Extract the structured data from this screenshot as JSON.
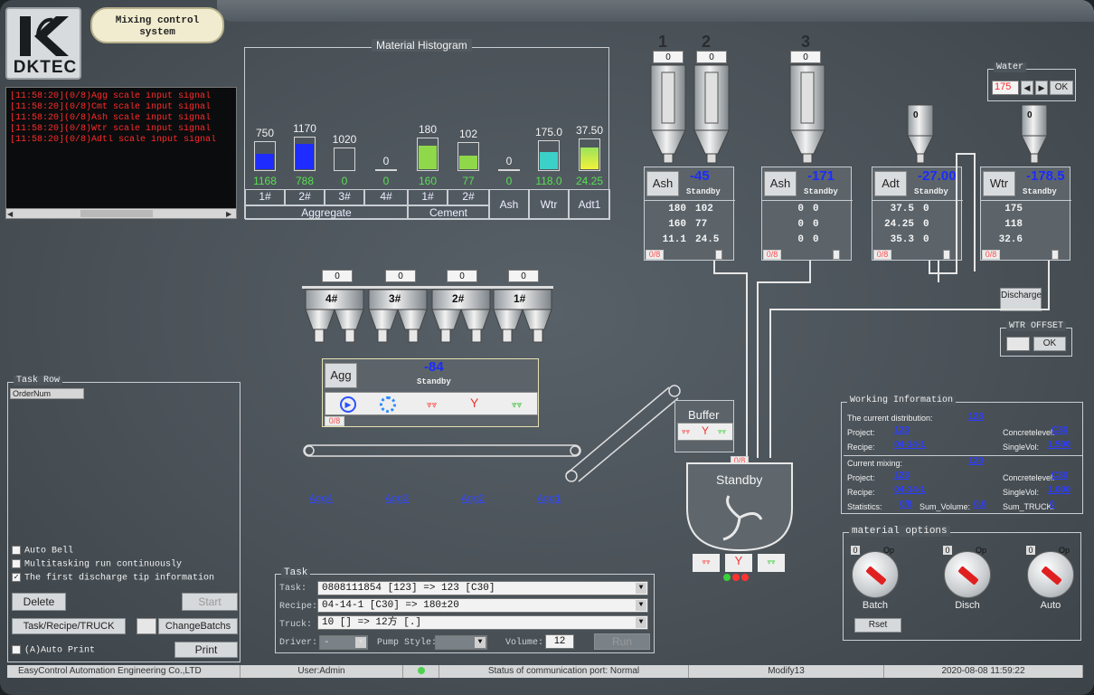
{
  "brand": {
    "logo_text": "DKTEC",
    "title_line1": "Mixing control",
    "title_line2": "system"
  },
  "log": {
    "lines": [
      "[11:58:20](0/8)Agg scale input signal",
      "[11:58:20](0/8)Cmt scale input signal",
      "[11:58:20](0/8)Ash scale input signal",
      "[11:58:20](0/8)Wtr scale input signal",
      "[11:58:20](0/8)Adtl scale input signal"
    ]
  },
  "histogram": {
    "title": "Material Histogram",
    "bars": [
      {
        "label": "1#",
        "top": "750",
        "bottom": "1168",
        "fill": 0.55,
        "color": "#1e2cff"
      },
      {
        "label": "2#",
        "top": "1170",
        "bottom": "788",
        "fill": 0.78,
        "color": "#1e2cff"
      },
      {
        "label": "3#",
        "top": "1020",
        "bottom": "0",
        "fill": 0.0,
        "color": "#1e2cff"
      },
      {
        "label": "4#",
        "top": "0",
        "bottom": "0",
        "fill": 0.0,
        "color": "#1e2cff"
      },
      {
        "label": "1#",
        "top": "180",
        "bottom": "160",
        "fill": 0.75,
        "color": "#8fd84a"
      },
      {
        "label": "2#",
        "top": "102",
        "bottom": "77",
        "fill": 0.5,
        "color": "#8fd84a"
      },
      {
        "label": "Ash",
        "top": "0",
        "bottom": "0",
        "fill": 0.0,
        "color": "#8fd84a"
      },
      {
        "label": "Wtr",
        "top": "175.0",
        "bottom": "118.0",
        "fill": 0.6,
        "color": "#3bd0c8"
      },
      {
        "label": "Adt1",
        "top": "37.50",
        "bottom": "24.25",
        "fill": 0.7,
        "color": "#e8e83a"
      }
    ],
    "groups": [
      "Aggregate",
      "Cement",
      "Ash",
      "Wtr",
      "Adt1"
    ]
  },
  "silos": {
    "numbers": [
      "1",
      "2",
      "3"
    ],
    "values": [
      "0",
      "0",
      "0"
    ],
    "small_values": [
      "0",
      "0"
    ]
  },
  "scales": [
    {
      "name": "Ash",
      "value": "-45",
      "status": "Standby",
      "rows": [
        [
          "180",
          "102"
        ],
        [
          "160",
          "77"
        ],
        [
          "11.1",
          "24.5"
        ]
      ],
      "tag": "0/8"
    },
    {
      "name": "Ash",
      "value": "-171",
      "status": "Standby",
      "rows": [
        [
          "0",
          "0"
        ],
        [
          "0",
          "0"
        ],
        [
          "0",
          "0"
        ]
      ],
      "tag": "0/8"
    },
    {
      "name": "Adt",
      "value": "-27.00",
      "status": "Standby",
      "rows": [
        [
          "37.5",
          "0"
        ],
        [
          "24.25",
          "0"
        ],
        [
          "35.3",
          "0"
        ]
      ],
      "tag": "0/8"
    },
    {
      "name": "Wtr",
      "value": "-178.5",
      "status": "Standby",
      "rows": [
        [
          "175",
          ""
        ],
        [
          "118",
          ""
        ],
        [
          "32.6",
          ""
        ]
      ],
      "tag": "0/8"
    }
  ],
  "water": {
    "label": "Water",
    "value": "175",
    "ok": "OK"
  },
  "discharge_label": "Discharge",
  "wtr_offset": {
    "label": "WTR OFFSET",
    "ok": "OK"
  },
  "bins": {
    "values": [
      "0",
      "0",
      "0",
      "0"
    ],
    "labels": [
      "4#",
      "3#",
      "2#",
      "1#"
    ]
  },
  "agg_scale": {
    "name": "Agg",
    "value": "-84",
    "status": "Standby",
    "tag": "0/8"
  },
  "agg_links": [
    "Agg4",
    "Agg3",
    "Agg2",
    "Agg1"
  ],
  "buffer": {
    "label": "Buffer",
    "tag": "0/8"
  },
  "mixer": {
    "status": "Standby"
  },
  "task_row": {
    "title": "Task Row",
    "column": "OrderNum"
  },
  "options_left": {
    "auto_bell": "Auto Bell",
    "multitask": "Multitasking run continuously",
    "first_discharge": "The first discharge tip information",
    "delete": "Delete",
    "start": "Start",
    "task_recipe_truck": "Task/Recipe/TRUCK",
    "change_batchs": "ChangeBatchs",
    "auto_print": "(A)Auto Print",
    "print": "Print"
  },
  "task": {
    "title": "Task",
    "task_label": "Task:",
    "task_value": "0808111854 [123] => 123 [C30]",
    "recipe_label": "Recipe:",
    "recipe_value": "04-14-1 [C30] => 180±20",
    "truck_label": "Truck:",
    "truck_value": "10 [] => 12方 [.]",
    "driver_label": "Driver:",
    "driver_value": "-",
    "pump_label": "Pump Style:",
    "volume_label": "Volume:",
    "volume_value": "12",
    "run": "Run"
  },
  "working_info": {
    "title": "Working Information",
    "current_distribution": "The current distribution:",
    "dist_value": "123",
    "project_label": "Project:",
    "project_value": "123",
    "recipe_label": "Recipe:",
    "recipe_value": "04-14-1",
    "concrete_label": "Concretelevel:",
    "concrete_value": "C30",
    "single_label": "SingleVol:",
    "single_value": "1.500",
    "current_mixing": "Current mixing:",
    "mix_value": "123",
    "project2_value": "123",
    "recipe2_value": "04-14-1",
    "concrete2_value": "C30",
    "single2_value": "1.000",
    "statistics_label": "Statistics:",
    "statistics_value": "0/8",
    "sum_volume_label": "Sum_Volume:",
    "sum_volume_value": "0.0",
    "sum_truck_label": "Sum_TRUCK:",
    "sum_truck_value": "0"
  },
  "material_options": {
    "title": "material options",
    "knobs": [
      {
        "label": "Batch",
        "left": "0",
        "right": "Op"
      },
      {
        "label": "Disch",
        "left": "0",
        "right": "Op"
      },
      {
        "label": "Auto",
        "left": "0",
        "right": "Op"
      }
    ],
    "reset": "Rset"
  },
  "statusbar": {
    "company": "EasyControl Automation Engineering Co.,LTD",
    "user": "User:Admin",
    "comm": "Status of communication port: Normal",
    "modify": "Modify13",
    "datetime": "2020-08-08 11:59:22"
  }
}
